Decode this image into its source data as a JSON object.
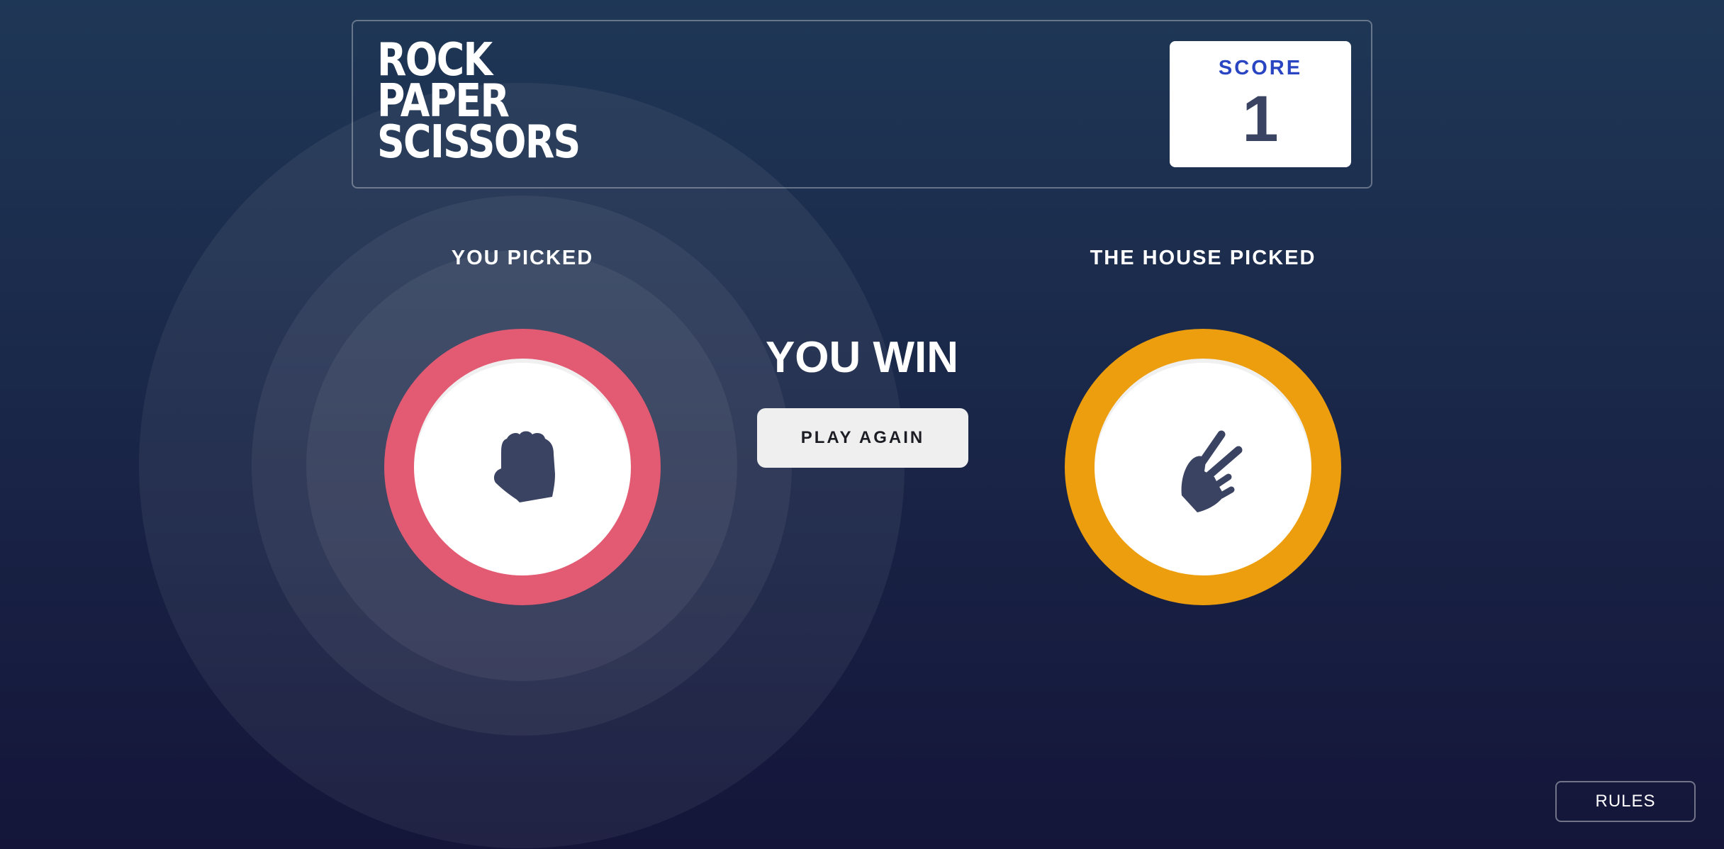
{
  "header": {
    "logo_lines": [
      "ROCK",
      "PAPER",
      "SCISSORS"
    ],
    "score_label": "SCORE",
    "score_value": "1"
  },
  "game": {
    "you_picked_label": "YOU PICKED",
    "house_picked_label": "THE HOUSE PICKED",
    "player_choice": "rock",
    "house_choice": "scissors",
    "result_text": "YOU WIN",
    "play_again_label": "PLAY AGAIN"
  },
  "footer": {
    "rules_label": "RULES"
  },
  "colors": {
    "rock": "#e35a73",
    "scissors": "#ec9e0e",
    "score_label": "#2a45c2",
    "score_value": "#3b4363",
    "icon": "#3b4363"
  },
  "icons": {
    "player_token_icon": "rock-hand-icon",
    "house_token_icon": "scissors-hand-icon"
  }
}
